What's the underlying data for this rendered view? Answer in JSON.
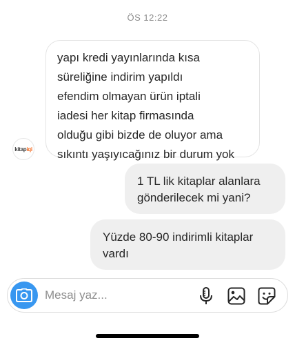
{
  "conversation": {
    "timestamp": "ÖS 12:22",
    "incoming_message": {
      "lines": [
        "yapı kredi yayınlarında kısa",
        "süreliğine indirim yapıldı",
        "efendim olmayan ürün iptali",
        "iadesi her kitap firmasında",
        "olduğu gibi bizde de oluyor ama",
        "sıkıntı yaşıyıcağınız bir durum yok"
      ]
    },
    "avatar": {
      "text_main": "kitap",
      "text_accent": "iqi",
      "accent_color": "#f26a21"
    },
    "outgoing_messages": [
      {
        "lines": [
          "1 TL lik kitaplar alanlara",
          "gönderilecek mi yani?"
        ]
      },
      {
        "lines": [
          "Yüzde 80-90 indirimli kitaplar",
          "vardı"
        ]
      }
    ]
  },
  "composer": {
    "placeholder": "Mesaj yaz...",
    "camera_icon": "camera-icon",
    "mic_icon": "microphone-icon",
    "gallery_icon": "image-icon",
    "sticker_icon": "sticker-icon",
    "camera_color": "#3897f0"
  }
}
